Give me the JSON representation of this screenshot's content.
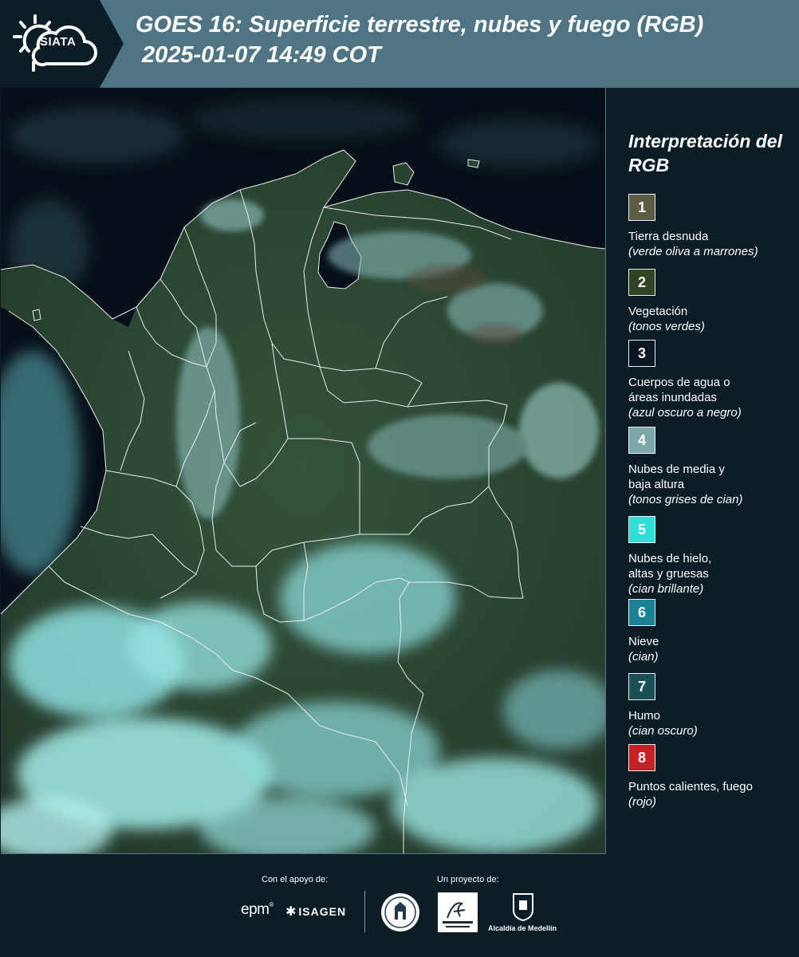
{
  "header": {
    "logo_text": "SIATA",
    "title_line1": "GOES 16: Superficie terrestre, nubes y fuego (RGB)",
    "title_line2": "2025-01-07 14:49 COT"
  },
  "legend": {
    "title": "Interpretación del RGB",
    "items": [
      {
        "number": "1",
        "label": "Tierra desnuda",
        "desc": "(verde oliva a marrones)",
        "color": "#5e5d43"
      },
      {
        "number": "2",
        "label": "Vegetación",
        "desc": "(tonos verdes)",
        "color": "#2f4524"
      },
      {
        "number": "3",
        "label": "Cuerpos de agua o áreas inundadas",
        "desc": "(azul oscuro a negro)",
        "color": "#0b1620"
      },
      {
        "number": "4",
        "label": "Nubes de media y baja altura",
        "desc": "(tonos grises de cian)",
        "color": "#7ea7a8"
      },
      {
        "number": "5",
        "label": "Nubes de hielo, altas y gruesas",
        "desc": "(cian brillante)",
        "color": "#2fdcd8"
      },
      {
        "number": "6",
        "label": "Nieve",
        "desc": "(cian)",
        "color": "#1b8194"
      },
      {
        "number": "7",
        "label": "Humo",
        "desc": "(cian oscuro)",
        "color": "#1c5057"
      },
      {
        "number": "8",
        "label": "Puntos calientes, fuego",
        "desc": "(rojo)",
        "color": "#c42026"
      }
    ]
  },
  "footer": {
    "support_label": "Con el apoyo de:",
    "project_label": "Un proyecto de:",
    "epm_logo": "epm",
    "isagen_logo": "ISAGEN",
    "medellin_label": "Alcaldía de Medellín"
  },
  "colors": {
    "header_bg": "#4f7585",
    "page_bg": "#0c1d28",
    "vegetation": "#2d4a32",
    "cloud_cyan": "#7fd3d6",
    "water": "#071018"
  }
}
